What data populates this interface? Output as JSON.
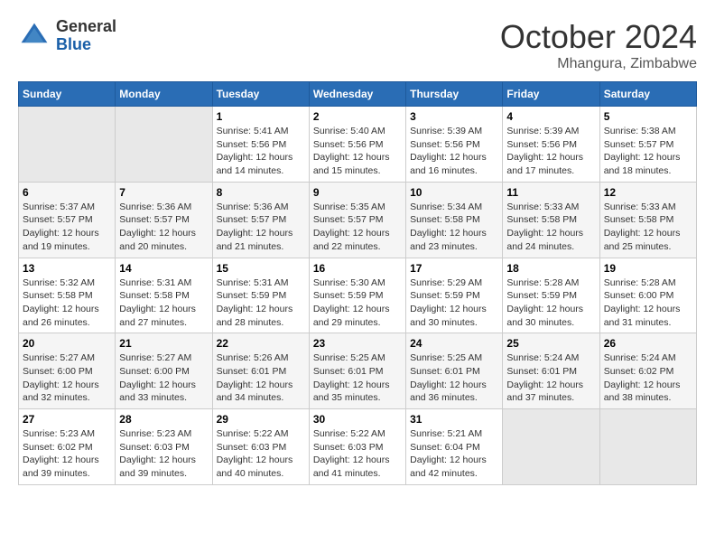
{
  "header": {
    "logo": {
      "general": "General",
      "blue": "Blue"
    },
    "title": "October 2024",
    "subtitle": "Mhangura, Zimbabwe"
  },
  "calendar": {
    "weekdays": [
      "Sunday",
      "Monday",
      "Tuesday",
      "Wednesday",
      "Thursday",
      "Friday",
      "Saturday"
    ],
    "weeks": [
      [
        {
          "day": "",
          "sunrise": "",
          "sunset": "",
          "daylight": ""
        },
        {
          "day": "",
          "sunrise": "",
          "sunset": "",
          "daylight": ""
        },
        {
          "day": "1",
          "sunrise": "Sunrise: 5:41 AM",
          "sunset": "Sunset: 5:56 PM",
          "daylight": "Daylight: 12 hours and 14 minutes."
        },
        {
          "day": "2",
          "sunrise": "Sunrise: 5:40 AM",
          "sunset": "Sunset: 5:56 PM",
          "daylight": "Daylight: 12 hours and 15 minutes."
        },
        {
          "day": "3",
          "sunrise": "Sunrise: 5:39 AM",
          "sunset": "Sunset: 5:56 PM",
          "daylight": "Daylight: 12 hours and 16 minutes."
        },
        {
          "day": "4",
          "sunrise": "Sunrise: 5:39 AM",
          "sunset": "Sunset: 5:56 PM",
          "daylight": "Daylight: 12 hours and 17 minutes."
        },
        {
          "day": "5",
          "sunrise": "Sunrise: 5:38 AM",
          "sunset": "Sunset: 5:57 PM",
          "daylight": "Daylight: 12 hours and 18 minutes."
        }
      ],
      [
        {
          "day": "6",
          "sunrise": "Sunrise: 5:37 AM",
          "sunset": "Sunset: 5:57 PM",
          "daylight": "Daylight: 12 hours and 19 minutes."
        },
        {
          "day": "7",
          "sunrise": "Sunrise: 5:36 AM",
          "sunset": "Sunset: 5:57 PM",
          "daylight": "Daylight: 12 hours and 20 minutes."
        },
        {
          "day": "8",
          "sunrise": "Sunrise: 5:36 AM",
          "sunset": "Sunset: 5:57 PM",
          "daylight": "Daylight: 12 hours and 21 minutes."
        },
        {
          "day": "9",
          "sunrise": "Sunrise: 5:35 AM",
          "sunset": "Sunset: 5:57 PM",
          "daylight": "Daylight: 12 hours and 22 minutes."
        },
        {
          "day": "10",
          "sunrise": "Sunrise: 5:34 AM",
          "sunset": "Sunset: 5:58 PM",
          "daylight": "Daylight: 12 hours and 23 minutes."
        },
        {
          "day": "11",
          "sunrise": "Sunrise: 5:33 AM",
          "sunset": "Sunset: 5:58 PM",
          "daylight": "Daylight: 12 hours and 24 minutes."
        },
        {
          "day": "12",
          "sunrise": "Sunrise: 5:33 AM",
          "sunset": "Sunset: 5:58 PM",
          "daylight": "Daylight: 12 hours and 25 minutes."
        }
      ],
      [
        {
          "day": "13",
          "sunrise": "Sunrise: 5:32 AM",
          "sunset": "Sunset: 5:58 PM",
          "daylight": "Daylight: 12 hours and 26 minutes."
        },
        {
          "day": "14",
          "sunrise": "Sunrise: 5:31 AM",
          "sunset": "Sunset: 5:58 PM",
          "daylight": "Daylight: 12 hours and 27 minutes."
        },
        {
          "day": "15",
          "sunrise": "Sunrise: 5:31 AM",
          "sunset": "Sunset: 5:59 PM",
          "daylight": "Daylight: 12 hours and 28 minutes."
        },
        {
          "day": "16",
          "sunrise": "Sunrise: 5:30 AM",
          "sunset": "Sunset: 5:59 PM",
          "daylight": "Daylight: 12 hours and 29 minutes."
        },
        {
          "day": "17",
          "sunrise": "Sunrise: 5:29 AM",
          "sunset": "Sunset: 5:59 PM",
          "daylight": "Daylight: 12 hours and 30 minutes."
        },
        {
          "day": "18",
          "sunrise": "Sunrise: 5:28 AM",
          "sunset": "Sunset: 5:59 PM",
          "daylight": "Daylight: 12 hours and 30 minutes."
        },
        {
          "day": "19",
          "sunrise": "Sunrise: 5:28 AM",
          "sunset": "Sunset: 6:00 PM",
          "daylight": "Daylight: 12 hours and 31 minutes."
        }
      ],
      [
        {
          "day": "20",
          "sunrise": "Sunrise: 5:27 AM",
          "sunset": "Sunset: 6:00 PM",
          "daylight": "Daylight: 12 hours and 32 minutes."
        },
        {
          "day": "21",
          "sunrise": "Sunrise: 5:27 AM",
          "sunset": "Sunset: 6:00 PM",
          "daylight": "Daylight: 12 hours and 33 minutes."
        },
        {
          "day": "22",
          "sunrise": "Sunrise: 5:26 AM",
          "sunset": "Sunset: 6:01 PM",
          "daylight": "Daylight: 12 hours and 34 minutes."
        },
        {
          "day": "23",
          "sunrise": "Sunrise: 5:25 AM",
          "sunset": "Sunset: 6:01 PM",
          "daylight": "Daylight: 12 hours and 35 minutes."
        },
        {
          "day": "24",
          "sunrise": "Sunrise: 5:25 AM",
          "sunset": "Sunset: 6:01 PM",
          "daylight": "Daylight: 12 hours and 36 minutes."
        },
        {
          "day": "25",
          "sunrise": "Sunrise: 5:24 AM",
          "sunset": "Sunset: 6:01 PM",
          "daylight": "Daylight: 12 hours and 37 minutes."
        },
        {
          "day": "26",
          "sunrise": "Sunrise: 5:24 AM",
          "sunset": "Sunset: 6:02 PM",
          "daylight": "Daylight: 12 hours and 38 minutes."
        }
      ],
      [
        {
          "day": "27",
          "sunrise": "Sunrise: 5:23 AM",
          "sunset": "Sunset: 6:02 PM",
          "daylight": "Daylight: 12 hours and 39 minutes."
        },
        {
          "day": "28",
          "sunrise": "Sunrise: 5:23 AM",
          "sunset": "Sunset: 6:03 PM",
          "daylight": "Daylight: 12 hours and 39 minutes."
        },
        {
          "day": "29",
          "sunrise": "Sunrise: 5:22 AM",
          "sunset": "Sunset: 6:03 PM",
          "daylight": "Daylight: 12 hours and 40 minutes."
        },
        {
          "day": "30",
          "sunrise": "Sunrise: 5:22 AM",
          "sunset": "Sunset: 6:03 PM",
          "daylight": "Daylight: 12 hours and 41 minutes."
        },
        {
          "day": "31",
          "sunrise": "Sunrise: 5:21 AM",
          "sunset": "Sunset: 6:04 PM",
          "daylight": "Daylight: 12 hours and 42 minutes."
        },
        {
          "day": "",
          "sunrise": "",
          "sunset": "",
          "daylight": ""
        },
        {
          "day": "",
          "sunrise": "",
          "sunset": "",
          "daylight": ""
        }
      ]
    ]
  }
}
